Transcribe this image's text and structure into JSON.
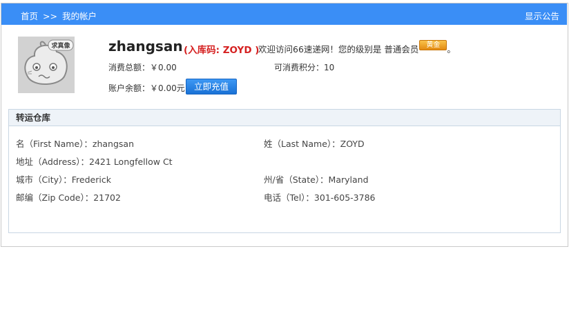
{
  "breadcrumb": {
    "home": "首页",
    "sep": ">>",
    "current": "我的帐户"
  },
  "notice_link": "显示公告",
  "avatar": {
    "label": "求真像"
  },
  "profile": {
    "username": "zhangsan",
    "warehouse_code": "(入库码: ZOYD )",
    "welcome_prefix": "欢迎访问66速递网！您的级别是",
    "level": "普通会员",
    "badge": "黄金",
    "period": "。"
  },
  "stats": {
    "total_spend": "消费总额：￥0.00",
    "points": "可消费积分：10",
    "balance": "账户余额：￥0.00元",
    "recharge_button": "立即充值"
  },
  "panel": {
    "title": "转运仓库",
    "first_name": "名（First Name）：zhangsan",
    "last_name": "姓（Last Name）：ZOYD",
    "address": "地址（Address）：2421 Longfellow Ct",
    "city": "城市（City）：Frederick",
    "state": "州/省（State）：Maryland",
    "zip": "邮编（Zip Code）：21702",
    "tel": "电话（Tel）：301-605-3786"
  },
  "colors": {
    "topbar": "#3a8ef6",
    "code_red": "#d52020",
    "button_blue": "#1a72d6"
  }
}
